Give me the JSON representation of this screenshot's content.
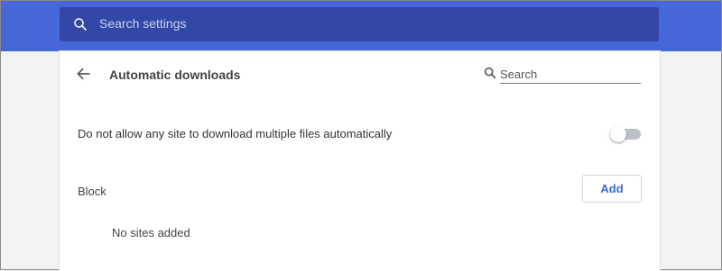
{
  "header": {
    "search_placeholder": "Search settings",
    "search_icon": "search-icon"
  },
  "page": {
    "title": "Automatic downloads",
    "back_icon": "arrow-left-icon",
    "search_placeholder": "Search"
  },
  "setting": {
    "label": "Do not allow any site to download multiple files automatically",
    "enabled": false
  },
  "block": {
    "label": "Block",
    "add_label": "Add",
    "empty_message": "No sites added"
  },
  "colors": {
    "header_bg": "#4668d6",
    "search_bg": "#3247a6",
    "accent": "#3b66d6"
  }
}
